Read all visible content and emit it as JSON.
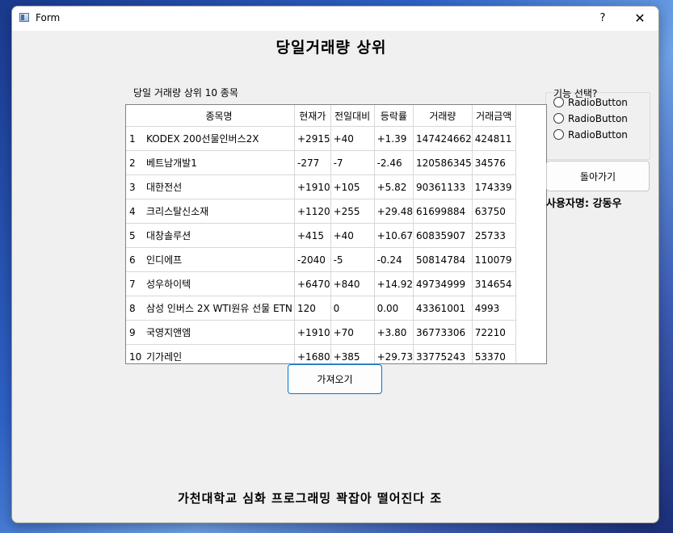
{
  "window": {
    "title": "Form",
    "help_label": "?",
    "close_label": "✕"
  },
  "heading": "당일거래량 상위",
  "group": {
    "label": "당일 거래량 상위 10 종목"
  },
  "table": {
    "headers": [
      "",
      "종목명",
      "현재가",
      "전일대비",
      "등락률",
      "거래량",
      "거래금액"
    ],
    "rows": [
      [
        "1",
        "KODEX 200선물인버스2X",
        "+2915",
        "+40",
        "+1.39",
        "147424662",
        "424811"
      ],
      [
        "2",
        "베트남개발1",
        "-277",
        "-7",
        "-2.46",
        "120586345",
        "34576"
      ],
      [
        "3",
        "대한전선",
        "+1910",
        "+105",
        "+5.82",
        "90361133",
        "174339"
      ],
      [
        "4",
        "크리스탈신소재",
        "+1120",
        "+255",
        "+29.48",
        "61699884",
        "63750"
      ],
      [
        "5",
        "대창솔루션",
        "+415",
        "+40",
        "+10.67",
        "60835907",
        "25733"
      ],
      [
        "6",
        "인디에프",
        "-2040",
        "-5",
        "-0.24",
        "50814784",
        "110079"
      ],
      [
        "7",
        "성우하이텍",
        "+6470",
        "+840",
        "+14.92",
        "49734999",
        "314654"
      ],
      [
        "8",
        "삼성 인버스 2X WTI원유 선물 ETN",
        "120",
        "0",
        "0.00",
        "43361001",
        "4993"
      ],
      [
        "9",
        "국영지앤엠",
        "+1910",
        "+70",
        "+3.80",
        "36773306",
        "72210"
      ],
      [
        "10",
        "기가레인",
        "+1680",
        "+385",
        "+29.73",
        "33775243",
        "53370"
      ]
    ]
  },
  "fetch_button": "가져오기",
  "feature": {
    "label": "기능 선택?",
    "radios": [
      "RadioButton",
      "RadioButton",
      "RadioButton"
    ]
  },
  "back_button": "돌아가기",
  "user_label": "사용자명: 강동우",
  "footer": "가천대학교 심화 프로그래밍 꽉잡아 떨어진다 조"
}
